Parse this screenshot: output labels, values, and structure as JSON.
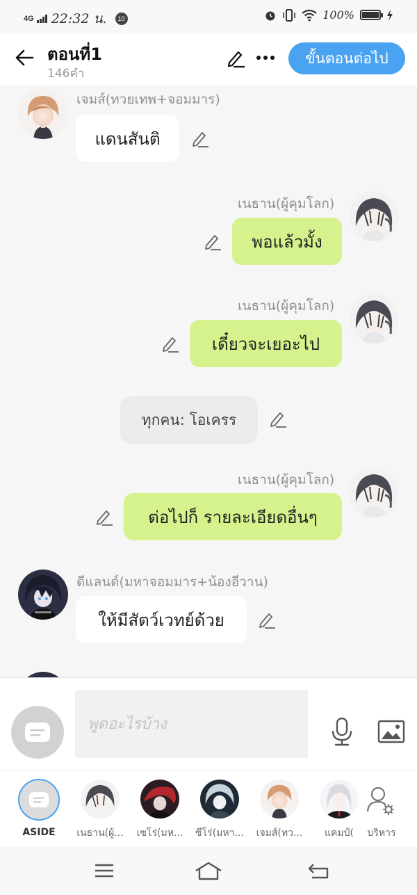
{
  "status": {
    "network": "4G",
    "time": "22:32 น.",
    "notif_count": "10",
    "battery": "100%"
  },
  "header": {
    "back_icon": "arrow-left-icon",
    "title": "ตอนที่1",
    "word_count": "146คำ",
    "edit_icon": "pencil-icon",
    "more_icon": "more-horizontal-icon",
    "next_label": "ขั้นตอนต่อไป"
  },
  "messages": [
    {
      "speaker": "เจมส์(ทวยเทพ+จอมมาร)",
      "text": "แดนสันติ",
      "side": "left"
    },
    {
      "speaker": "เนธาน(ผู้คุมโลก)",
      "text": "พอแล้วมั้ง",
      "side": "right"
    },
    {
      "speaker": "เนธาน(ผู้คุมโลก)",
      "text": "เดี๋ยวจะเยอะไป",
      "side": "right"
    },
    {
      "speaker": "",
      "text": "ทุกคน: โอเครร",
      "side": "center"
    },
    {
      "speaker": "เนธาน(ผู้คุมโลก)",
      "text": "ต่อไปก็ รายละเอียดอื่นๆ",
      "side": "right"
    },
    {
      "speaker": "ดีแลนด์(มหาจอมมาร+น้องอีวาน)",
      "text": "ให้มีสัตว์เวทย์ด้วย",
      "side": "left"
    }
  ],
  "composer": {
    "placeholder": "พูดอะไรบ้าง",
    "aside_icon": "message-box-icon",
    "mic_icon": "microphone-icon",
    "image_icon": "image-icon"
  },
  "characters": [
    {
      "label": "ASIDE"
    },
    {
      "label": "เนธาน(ผู้..."
    },
    {
      "label": "เซโร่(มห..."
    },
    {
      "label": "ซีโร่(มหา..."
    },
    {
      "label": "เจมส์(ทว..."
    },
    {
      "label": "แคมป์("
    },
    {
      "label": "บริหาร"
    }
  ],
  "nav": {
    "menu_icon": "menu-icon",
    "home_icon": "home-icon",
    "back_icon": "back-icon"
  },
  "colors": {
    "accent": "#4aa3f0",
    "bubble_self": "#d6f28c",
    "bubble_other": "#ffffff",
    "narration": "#ececec"
  }
}
